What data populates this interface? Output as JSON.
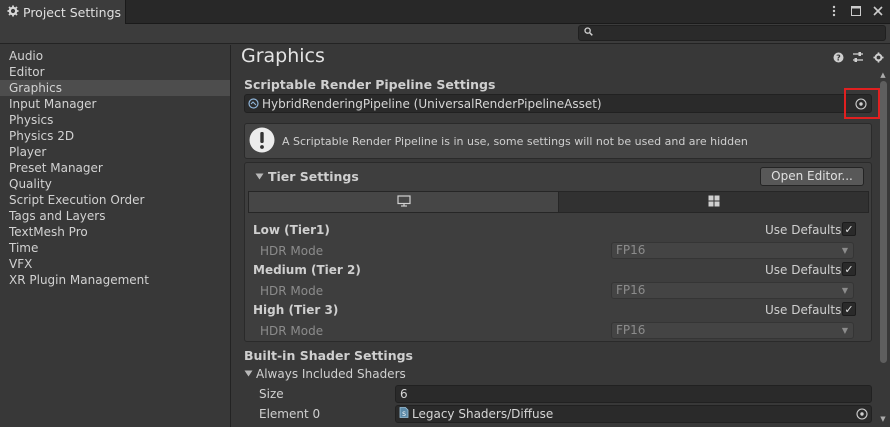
{
  "window": {
    "tab_title": "Project Settings",
    "search_placeholder": ""
  },
  "sidebar": {
    "items": [
      {
        "label": "Audio",
        "selected": false
      },
      {
        "label": "Editor",
        "selected": false
      },
      {
        "label": "Graphics",
        "selected": true
      },
      {
        "label": "Input Manager",
        "selected": false
      },
      {
        "label": "Physics",
        "selected": false
      },
      {
        "label": "Physics 2D",
        "selected": false
      },
      {
        "label": "Player",
        "selected": false
      },
      {
        "label": "Preset Manager",
        "selected": false
      },
      {
        "label": "Quality",
        "selected": false
      },
      {
        "label": "Script Execution Order",
        "selected": false
      },
      {
        "label": "Tags and Layers",
        "selected": false
      },
      {
        "label": "TextMesh Pro",
        "selected": false
      },
      {
        "label": "Time",
        "selected": false
      },
      {
        "label": "VFX",
        "selected": false
      },
      {
        "label": "XR Plugin Management",
        "selected": false
      }
    ]
  },
  "main": {
    "title": "Graphics",
    "srp_section_label": "Scriptable Render Pipeline Settings",
    "srp_asset_value": "HybridRenderingPipeline (UniversalRenderPipelineAsset)",
    "help_message": "A Scriptable Render Pipeline is in use, some settings will not be used and are hidden",
    "tier_settings": {
      "header": "Tier Settings",
      "open_editor_label": "Open Editor...",
      "tiers": [
        {
          "name": "Low (Tier1)",
          "use_defaults_label": "Use Defaults",
          "use_defaults": true,
          "hdr_label": "HDR Mode",
          "hdr_value": "FP16"
        },
        {
          "name": "Medium (Tier 2)",
          "use_defaults_label": "Use Defaults",
          "use_defaults": true,
          "hdr_label": "HDR Mode",
          "hdr_value": "FP16"
        },
        {
          "name": "High (Tier 3)",
          "use_defaults_label": "Use Defaults",
          "use_defaults": true,
          "hdr_label": "HDR Mode",
          "hdr_value": "FP16"
        }
      ]
    },
    "builtin_section_label": "Built-in Shader Settings",
    "always_included": {
      "label": "Always Included Shaders",
      "size_label": "Size",
      "size_value": "6",
      "element0_label": "Element 0",
      "element0_value": "Legacy Shaders/Diffuse"
    }
  },
  "colors": {
    "highlight": "#e02020",
    "background": "#383838"
  }
}
